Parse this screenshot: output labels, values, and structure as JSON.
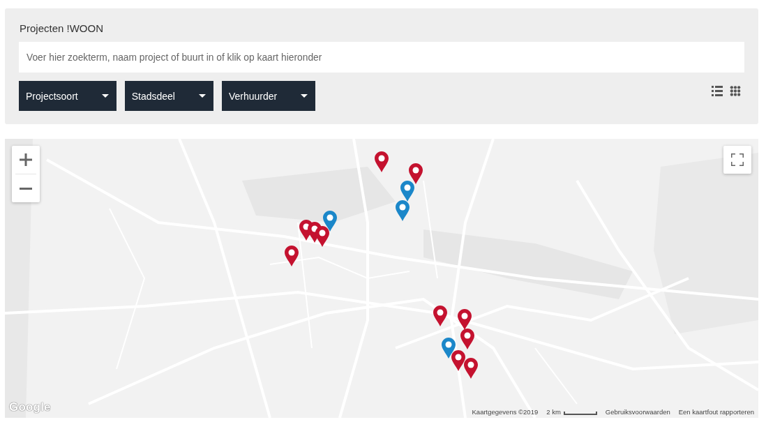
{
  "panel": {
    "title": "Projecten !WOON",
    "search": {
      "placeholder": "Voer hier zoekterm, naam project of buurt in of klik op kaart hieronder"
    },
    "filters": [
      {
        "label": "Projectsoort"
      },
      {
        "label": "Stadsdeel"
      },
      {
        "label": "Verhuurder"
      }
    ],
    "view_options": [
      {
        "kind": "list"
      },
      {
        "kind": "grid"
      }
    ]
  },
  "map": {
    "markers": [
      {
        "color": "#c4122f"
      },
      {
        "color": "#c4122f"
      },
      {
        "color": "#1b87c9"
      },
      {
        "color": "#1b87c9"
      },
      {
        "color": "#1b87c9"
      },
      {
        "color": "#c4122f"
      },
      {
        "color": "#c4122f"
      },
      {
        "color": "#c4122f"
      },
      {
        "color": "#c4122f"
      },
      {
        "color": "#c4122f"
      },
      {
        "color": "#c4122f"
      },
      {
        "color": "#c4122f"
      },
      {
        "color": "#1b87c9"
      },
      {
        "color": "#c4122f"
      },
      {
        "color": "#c4122f"
      }
    ],
    "logo": "Google",
    "attribution": {
      "map_data": "Kaartgegevens ©2019",
      "scale": "2 km",
      "terms": "Gebruiksvoorwaarden",
      "report_error": "Een kaartfout rapporteren"
    }
  }
}
